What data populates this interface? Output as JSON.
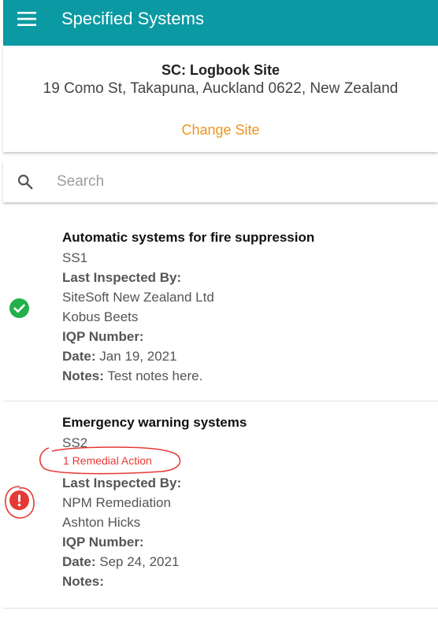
{
  "appbar": {
    "title": "Specified Systems",
    "menu_icon": "hamburger-menu-icon",
    "color": "#0b9aa3"
  },
  "site": {
    "name": "SC: Logbook Site",
    "address": "19 Como St, Takapuna, Auckland 0622, New Zealand",
    "change_label": "Change Site",
    "accent_color": "#f0941d"
  },
  "search": {
    "placeholder": "Search",
    "icon": "search-icon"
  },
  "systems": [
    {
      "title": "Automatic systems for fire suppression",
      "code": "SS1",
      "status": "ok",
      "status_icon": "check-circle-icon",
      "status_color": "#21b04b",
      "last_inspected_label": "Last Inspected By:",
      "company": "SiteSoft New Zealand Ltd",
      "inspector": "Kobus Beets",
      "iqp_label": "IQP Number:",
      "iqp_value": "",
      "date_label": "Date:",
      "date_value": "Jan 19, 2021",
      "notes_label": "Notes:",
      "notes_value": "Test notes here."
    },
    {
      "title": "Emergency warning systems",
      "code": "SS2",
      "status": "alert",
      "status_icon": "alert-circle-icon",
      "status_color": "#e53935",
      "remedial": "1 Remedial Action",
      "last_inspected_label": "Last Inspected By:",
      "company": "NPM Remediation",
      "inspector": "Ashton Hicks",
      "iqp_label": "IQP Number:",
      "iqp_value": "",
      "date_label": "Date:",
      "date_value": "Sep 24, 2021",
      "notes_label": "Notes:",
      "notes_value": ""
    }
  ]
}
